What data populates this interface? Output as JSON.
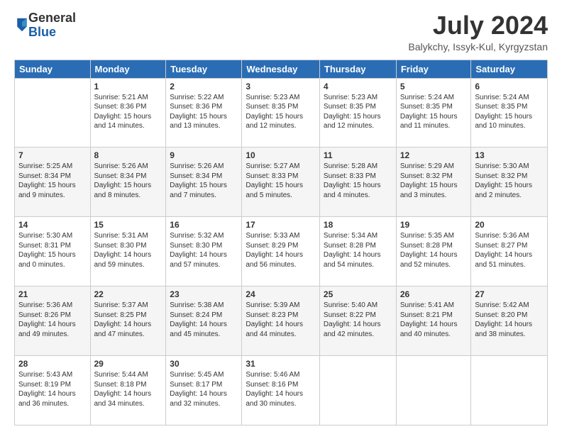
{
  "header": {
    "logo_general": "General",
    "logo_blue": "Blue",
    "month_title": "July 2024",
    "location": "Balykchy, Issyk-Kul, Kyrgyzstan"
  },
  "days_of_week": [
    "Sunday",
    "Monday",
    "Tuesday",
    "Wednesday",
    "Thursday",
    "Friday",
    "Saturday"
  ],
  "weeks": [
    [
      {
        "day": "",
        "info": ""
      },
      {
        "day": "1",
        "info": "Sunrise: 5:21 AM\nSunset: 8:36 PM\nDaylight: 15 hours\nand 14 minutes."
      },
      {
        "day": "2",
        "info": "Sunrise: 5:22 AM\nSunset: 8:36 PM\nDaylight: 15 hours\nand 13 minutes."
      },
      {
        "day": "3",
        "info": "Sunrise: 5:23 AM\nSunset: 8:35 PM\nDaylight: 15 hours\nand 12 minutes."
      },
      {
        "day": "4",
        "info": "Sunrise: 5:23 AM\nSunset: 8:35 PM\nDaylight: 15 hours\nand 12 minutes."
      },
      {
        "day": "5",
        "info": "Sunrise: 5:24 AM\nSunset: 8:35 PM\nDaylight: 15 hours\nand 11 minutes."
      },
      {
        "day": "6",
        "info": "Sunrise: 5:24 AM\nSunset: 8:35 PM\nDaylight: 15 hours\nand 10 minutes."
      }
    ],
    [
      {
        "day": "7",
        "info": "Sunrise: 5:25 AM\nSunset: 8:34 PM\nDaylight: 15 hours\nand 9 minutes."
      },
      {
        "day": "8",
        "info": "Sunrise: 5:26 AM\nSunset: 8:34 PM\nDaylight: 15 hours\nand 8 minutes."
      },
      {
        "day": "9",
        "info": "Sunrise: 5:26 AM\nSunset: 8:34 PM\nDaylight: 15 hours\nand 7 minutes."
      },
      {
        "day": "10",
        "info": "Sunrise: 5:27 AM\nSunset: 8:33 PM\nDaylight: 15 hours\nand 5 minutes."
      },
      {
        "day": "11",
        "info": "Sunrise: 5:28 AM\nSunset: 8:33 PM\nDaylight: 15 hours\nand 4 minutes."
      },
      {
        "day": "12",
        "info": "Sunrise: 5:29 AM\nSunset: 8:32 PM\nDaylight: 15 hours\nand 3 minutes."
      },
      {
        "day": "13",
        "info": "Sunrise: 5:30 AM\nSunset: 8:32 PM\nDaylight: 15 hours\nand 2 minutes."
      }
    ],
    [
      {
        "day": "14",
        "info": "Sunrise: 5:30 AM\nSunset: 8:31 PM\nDaylight: 15 hours\nand 0 minutes."
      },
      {
        "day": "15",
        "info": "Sunrise: 5:31 AM\nSunset: 8:30 PM\nDaylight: 14 hours\nand 59 minutes."
      },
      {
        "day": "16",
        "info": "Sunrise: 5:32 AM\nSunset: 8:30 PM\nDaylight: 14 hours\nand 57 minutes."
      },
      {
        "day": "17",
        "info": "Sunrise: 5:33 AM\nSunset: 8:29 PM\nDaylight: 14 hours\nand 56 minutes."
      },
      {
        "day": "18",
        "info": "Sunrise: 5:34 AM\nSunset: 8:28 PM\nDaylight: 14 hours\nand 54 minutes."
      },
      {
        "day": "19",
        "info": "Sunrise: 5:35 AM\nSunset: 8:28 PM\nDaylight: 14 hours\nand 52 minutes."
      },
      {
        "day": "20",
        "info": "Sunrise: 5:36 AM\nSunset: 8:27 PM\nDaylight: 14 hours\nand 51 minutes."
      }
    ],
    [
      {
        "day": "21",
        "info": "Sunrise: 5:36 AM\nSunset: 8:26 PM\nDaylight: 14 hours\nand 49 minutes."
      },
      {
        "day": "22",
        "info": "Sunrise: 5:37 AM\nSunset: 8:25 PM\nDaylight: 14 hours\nand 47 minutes."
      },
      {
        "day": "23",
        "info": "Sunrise: 5:38 AM\nSunset: 8:24 PM\nDaylight: 14 hours\nand 45 minutes."
      },
      {
        "day": "24",
        "info": "Sunrise: 5:39 AM\nSunset: 8:23 PM\nDaylight: 14 hours\nand 44 minutes."
      },
      {
        "day": "25",
        "info": "Sunrise: 5:40 AM\nSunset: 8:22 PM\nDaylight: 14 hours\nand 42 minutes."
      },
      {
        "day": "26",
        "info": "Sunrise: 5:41 AM\nSunset: 8:21 PM\nDaylight: 14 hours\nand 40 minutes."
      },
      {
        "day": "27",
        "info": "Sunrise: 5:42 AM\nSunset: 8:20 PM\nDaylight: 14 hours\nand 38 minutes."
      }
    ],
    [
      {
        "day": "28",
        "info": "Sunrise: 5:43 AM\nSunset: 8:19 PM\nDaylight: 14 hours\nand 36 minutes."
      },
      {
        "day": "29",
        "info": "Sunrise: 5:44 AM\nSunset: 8:18 PM\nDaylight: 14 hours\nand 34 minutes."
      },
      {
        "day": "30",
        "info": "Sunrise: 5:45 AM\nSunset: 8:17 PM\nDaylight: 14 hours\nand 32 minutes."
      },
      {
        "day": "31",
        "info": "Sunrise: 5:46 AM\nSunset: 8:16 PM\nDaylight: 14 hours\nand 30 minutes."
      },
      {
        "day": "",
        "info": ""
      },
      {
        "day": "",
        "info": ""
      },
      {
        "day": "",
        "info": ""
      }
    ]
  ]
}
